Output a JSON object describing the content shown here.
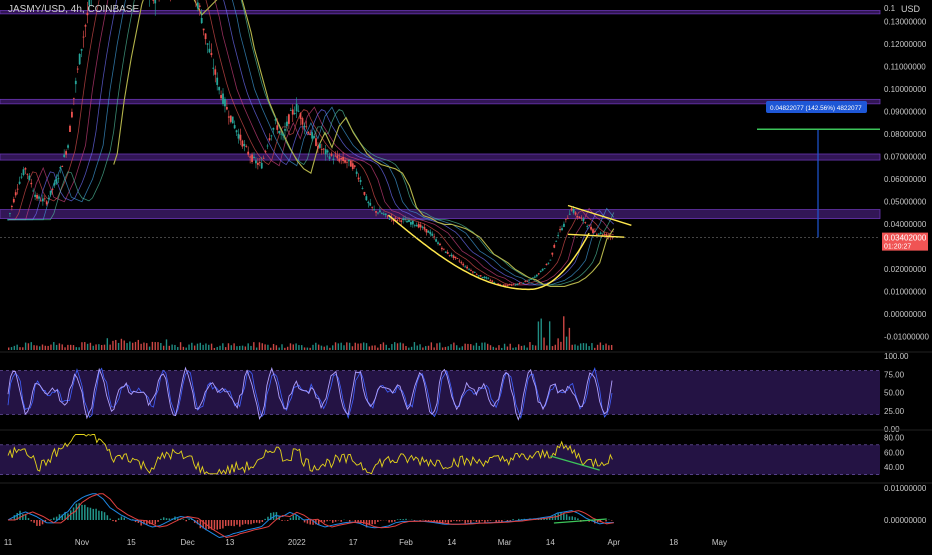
{
  "header": {
    "symbol_title": "JASMY/USD, 4h, COINBASE",
    "currency": "USD"
  },
  "colors": {
    "background": "#000000",
    "up": "#26a69a",
    "down": "#ef5350",
    "zone_fill": "#3b1a66",
    "zone_border": "#7b3fcf",
    "curve": "#ffe84d",
    "ema_slow": "#b3b34a",
    "measure_line": "#1e57d6",
    "target_line": "#3cc45a",
    "price_badge": "#f05454",
    "rsi_line": "#8c7cff",
    "stoch_line": "#e5d41a",
    "divergence": "#3cc45a",
    "macd_line": "#1e88e5",
    "signal_line": "#e04040"
  },
  "price_axis": {
    "ticks": [
      "0.13000000",
      "0.12000000",
      "0.11000000",
      "0.10000000",
      "0.09000000",
      "0.08000000",
      "0.07000000",
      "0.06000000",
      "0.05000000",
      "0.04000000",
      "0.02000000",
      "0.01000000",
      "0.00000000",
      "-0.01000000"
    ],
    "tick_values": [
      0.13,
      0.12,
      0.11,
      0.1,
      0.09,
      0.08,
      0.07,
      0.06,
      0.05,
      0.04,
      0.02,
      0.01,
      0.0,
      -0.01
    ],
    "top_partial_label": "0.1",
    "range": [
      -0.0115,
      0.137
    ]
  },
  "current_price": {
    "value": 0.03402,
    "label": "0.03402000",
    "countdown": "01:20:27"
  },
  "measure": {
    "label": "0.04822077 (142.56%) 4822077",
    "from": 0.0341,
    "to": 0.0822
  },
  "zones": [
    {
      "top": 0.135,
      "bottom": 0.1335
    },
    {
      "top": 0.0955,
      "bottom": 0.0935
    },
    {
      "top": 0.0712,
      "bottom": 0.0685
    },
    {
      "top": 0.0465,
      "bottom": 0.0425
    }
  ],
  "x_axis": {
    "labels": [
      "11",
      "Nov",
      "15",
      "Dec",
      "13",
      "2022",
      "17",
      "Feb",
      "14",
      "Mar",
      "14",
      "Apr",
      "18",
      "May"
    ]
  },
  "rsi_pane": {
    "ticks": [
      "100.00",
      "75.00",
      "50.00",
      "25.00",
      "0.00"
    ],
    "tick_values": [
      100,
      75,
      50,
      25,
      0
    ],
    "band": [
      80,
      20
    ]
  },
  "stoch_pane": {
    "ticks": [
      "80.00",
      "60.00",
      "40.00"
    ],
    "tick_values": [
      80,
      60,
      40
    ],
    "band": [
      70,
      30
    ]
  },
  "macd_pane": {
    "ticks": [
      "0.01000000",
      "0.00000000"
    ],
    "tick_values": [
      0.01,
      0.0
    ]
  },
  "chart_data": {
    "type": "line",
    "title": "JASMY/USD, 4h, COINBASE",
    "xlabel": "",
    "ylabel": "",
    "x": [
      "Oct 11",
      "Nov 1",
      "Nov 15",
      "Dec 1",
      "Dec 13",
      "Jan 1 2022",
      "Jan 17",
      "Feb 1",
      "Feb 14",
      "Mar 1",
      "Mar 14",
      "Apr 1",
      "Apr 18",
      "May 1"
    ],
    "x_positions": [
      0,
      21,
      35,
      51,
      63,
      82,
      98,
      113,
      126,
      141,
      154,
      172,
      189,
      202
    ],
    "series": [
      {
        "values_x": [
          0,
          3,
          5,
          8,
          11,
          14,
          17,
          19,
          21,
          24,
          27,
          29,
          32,
          35,
          38,
          41,
          44,
          47,
          50,
          52,
          54,
          55,
          56,
          58,
          60,
          62,
          64,
          66,
          68,
          70,
          72,
          74,
          76,
          78,
          80,
          82,
          84,
          86,
          88,
          90,
          92,
          94,
          96,
          98,
          100,
          102,
          104,
          106,
          108,
          110,
          112,
          114,
          116,
          118,
          120,
          122,
          124,
          126,
          128,
          130,
          132,
          134,
          136,
          138,
          140,
          142,
          144,
          146,
          148,
          150,
          152,
          154,
          156,
          158,
          160,
          162,
          164,
          166,
          168,
          170,
          172
        ],
        "values_y": [
          0.042,
          0.058,
          0.065,
          0.052,
          0.05,
          0.06,
          0.075,
          0.1,
          0.12,
          0.145,
          0.16,
          0.155,
          0.16,
          0.16,
          0.15,
          0.14,
          0.145,
          0.15,
          0.15,
          0.15,
          0.138,
          0.132,
          0.124,
          0.112,
          0.1,
          0.092,
          0.085,
          0.078,
          0.072,
          0.068,
          0.066,
          0.078,
          0.085,
          0.078,
          0.088,
          0.092,
          0.085,
          0.08,
          0.075,
          0.072,
          0.07,
          0.069,
          0.068,
          0.066,
          0.06,
          0.05,
          0.046,
          0.045,
          0.043,
          0.042,
          0.042,
          0.041,
          0.04,
          0.038,
          0.036,
          0.032,
          0.028,
          0.026,
          0.024,
          0.021,
          0.019,
          0.017,
          0.016,
          0.014,
          0.013,
          0.013,
          0.013,
          0.014,
          0.015,
          0.017,
          0.02,
          0.024,
          0.035,
          0.04,
          0.047,
          0.043,
          0.041,
          0.037,
          0.036,
          0.035,
          0.034
        ]
      }
    ],
    "price_range": [
      -0.0115,
      0.137
    ]
  }
}
